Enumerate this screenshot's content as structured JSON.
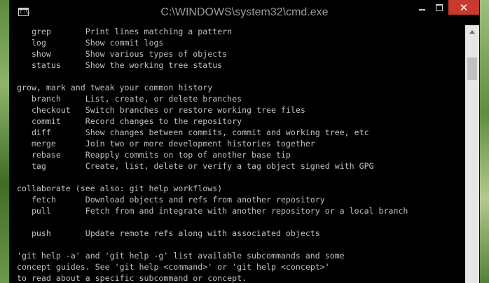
{
  "window": {
    "title": "C:\\WINDOWS\\system32\\cmd.exe",
    "icon_label": "C:\\."
  },
  "controls": {
    "minimize": "",
    "maximize": "",
    "close": "✕"
  },
  "console": {
    "lines": [
      "   grep       Print lines matching a pattern",
      "   log        Show commit logs",
      "   show       Show various types of objects",
      "   status     Show the working tree status",
      "",
      "grow, mark and tweak your common history",
      "   branch     List, create, or delete branches",
      "   checkout   Switch branches or restore working tree files",
      "   commit     Record changes to the repository",
      "   diff       Show changes between commits, commit and working tree, etc",
      "   merge      Join two or more development histories together",
      "   rebase     Reapply commits on top of another base tip",
      "   tag        Create, list, delete or verify a tag object signed with GPG",
      "",
      "collaborate (see also: git help workflows)",
      "   fetch      Download objects and refs from another repository",
      "   pull       Fetch from and integrate with another repository or a local branch",
      "",
      "   push       Update remote refs along with associated objects",
      "",
      "'git help -a' and 'git help -g' list available subcommands and some",
      "concept guides. See 'git help <command>' or 'git help <concept>'",
      "to read about a specific subcommand or concept."
    ]
  },
  "colors": {
    "console_bg": "#000000",
    "console_text": "#c0c0c0",
    "close_button": "#c83a2d"
  }
}
